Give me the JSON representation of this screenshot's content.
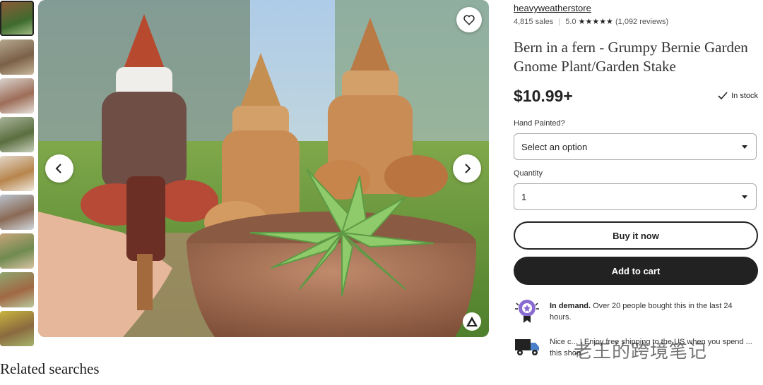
{
  "shop": {
    "name": "heavyweatherstore",
    "sales": "4,815 sales",
    "rating": "5.0",
    "stars": "★★★★★",
    "reviews": "(1,092 reviews)"
  },
  "product": {
    "title": "Bern in a fern - Grumpy Bernie Garden Gnome Plant/Garden Stake",
    "price": "$10.99+",
    "stock": "In stock"
  },
  "options": {
    "hand_painted_label": "Hand Painted?",
    "hand_painted_value": "Select an option",
    "quantity_label": "Quantity",
    "quantity_value": "1"
  },
  "actions": {
    "buy_now": "Buy it now",
    "add_to_cart": "Add to cart"
  },
  "highlights": {
    "demand_title": "In demand.",
    "demand_text": "Over 20 people bought this in the last 24 hours.",
    "shipping_text": "Nice c... ! Enjoy free shipping to the US when you spend ... this shop."
  },
  "related": {
    "heading": "Related searches"
  },
  "watermark": "老王的跨境笔记",
  "thumbnails_count": 9,
  "colors": {
    "accent_dark": "#222222",
    "star": "#222222",
    "demand_badge": "#8a6bd1"
  }
}
